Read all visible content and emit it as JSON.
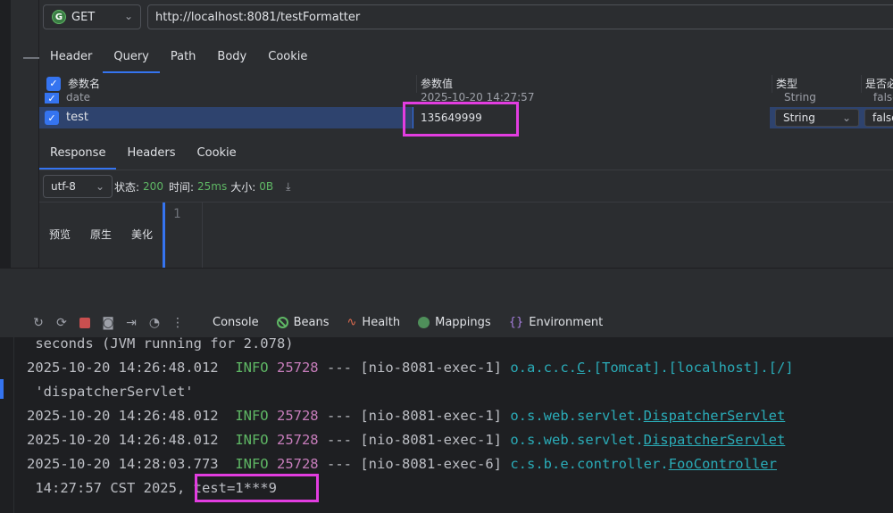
{
  "request": {
    "method": "GET",
    "url": "http://localhost:8081/testFormatter",
    "tabs": [
      "Header",
      "Query",
      "Path",
      "Body",
      "Cookie"
    ],
    "active_tab": "Query"
  },
  "params_table": {
    "headers": {
      "name": "参数名",
      "value": "参数值",
      "type": "类型",
      "required": "是否必"
    },
    "rows": [
      {
        "name": "date",
        "value": "2025-10-20 14:27:57",
        "type": "String",
        "required": "false"
      },
      {
        "name": "test",
        "value": "135649999",
        "type": "String",
        "required": "false"
      }
    ]
  },
  "response": {
    "tabs": [
      "Response",
      "Headers",
      "Cookie"
    ],
    "active_tab": "Response",
    "encoding": "utf-8",
    "status_label": "状态:",
    "status_value": "200",
    "time_label": "时间:",
    "time_value": "25ms",
    "size_label": "大小:",
    "size_value": "0B",
    "view_modes": [
      "预览",
      "原生",
      "美化"
    ],
    "line_number": "1"
  },
  "console_toolbar": {
    "tabs": [
      "Console",
      "Beans",
      "Health",
      "Mappings",
      "Environment"
    ],
    "active_tab": "Console",
    "icons": [
      "rerun-icon",
      "restart-icon",
      "stop-icon",
      "camera-icon",
      "exit-icon",
      "gauge-icon",
      "more-icon"
    ]
  },
  "console_lines": [
    {
      "text": " seconds (JVM running for 2.078)"
    },
    {
      "ts": "2025-10-20 14:26:48.012",
      "level": "INFO",
      "pid": "25728",
      "sep": "---",
      "thread": "[nio-8081-exec-1]",
      "logger_plain": "o.a.c.c.",
      "logger_ul": "C",
      "logger_rest": ".[Tomcat].[localhost].[/]"
    },
    {
      "text": " 'dispatcherServlet'"
    },
    {
      "ts": "2025-10-20 14:26:48.012",
      "level": "INFO",
      "pid": "25728",
      "sep": "---",
      "thread": "[nio-8081-exec-1]",
      "logger_plain": "o.s.web.servlet.",
      "logger_ul": "DispatcherServlet",
      "logger_rest": ""
    },
    {
      "ts": "2025-10-20 14:26:48.012",
      "level": "INFO",
      "pid": "25728",
      "sep": "---",
      "thread": "[nio-8081-exec-1]",
      "logger_plain": "o.s.web.servlet.",
      "logger_ul": "DispatcherServlet",
      "logger_rest": ""
    },
    {
      "ts": "2025-10-20 14:28:03.773",
      "level": "INFO",
      "pid": "25728",
      "sep": "---",
      "thread": "[nio-8081-exec-6]",
      "logger_plain": "c.s.b.e.controller.",
      "logger_ul": "FooController",
      "logger_rest": ""
    },
    {
      "text": " 14:27:57 CST 2025,",
      "highlight": " test=1***9"
    }
  ],
  "colors": {
    "accent": "#3574f0",
    "highlight_box": "#e23de0",
    "info": "#5fb865",
    "pid": "#c77dbb",
    "logger": "#2aacb8"
  }
}
